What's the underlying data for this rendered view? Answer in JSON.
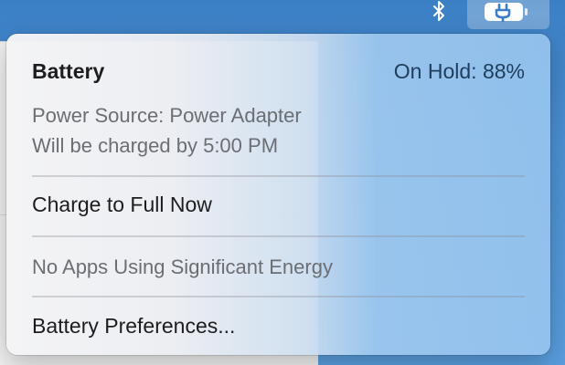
{
  "menubar": {
    "bluetooth_icon": "bluetooth-icon",
    "battery_icon": "battery-charging-plug-icon"
  },
  "battery_menu": {
    "title": "Battery",
    "status": "On Hold: 88%",
    "power_source": "Power Source: Power Adapter",
    "charge_time": "Will be charged by 5:00 PM",
    "charge_full_label": "Charge to Full Now",
    "energy_note": "No Apps Using Significant Energy",
    "preferences_label": "Battery Preferences..."
  },
  "colors": {
    "desktop": "#4a8fd4",
    "status_text": "#1f3d5c",
    "secondary_text": "#6b6e73"
  }
}
